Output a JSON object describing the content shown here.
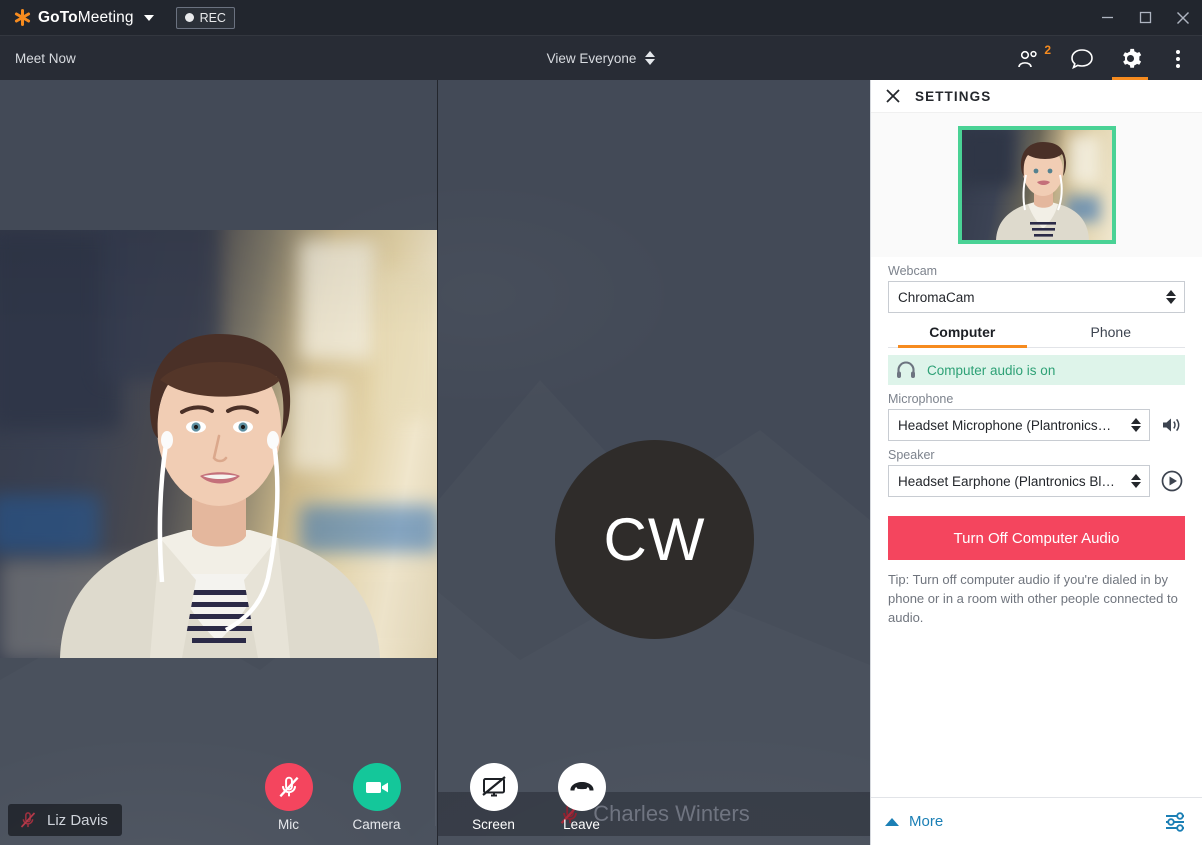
{
  "titlebar": {
    "brand_bold": "GoTo",
    "brand_rest": "Meeting",
    "logo_icon": "asterisk-logo-icon",
    "brand_caret_icon": "chevron-down-icon",
    "rec_label": "REC",
    "rec_dot_icon": "record-dot-icon",
    "minimize_icon": "minimize-icon",
    "maximize_icon": "maximize-icon",
    "close_icon": "close-icon"
  },
  "toolbar": {
    "meet_now_label": "Meet Now",
    "view_mode_label": "View Everyone",
    "view_mode_stepper_icon": "stepper-updown-icon",
    "people_icon": "people-icon",
    "people_count": "2",
    "chat_icon": "chat-bubble-icon",
    "settings_icon": "gear-icon",
    "settings_active": true,
    "overflow_icon": "kebab-menu-icon",
    "active_accent": "#f68b1f"
  },
  "stage": {
    "background_color": "#434a57",
    "local_video": {
      "name": "Liz Davis",
      "mic_state_icon": "mic-muted-icon",
      "muted": true
    },
    "remote_participant": {
      "initials": "CW",
      "name": "Charles Winters",
      "mic_state_icon": "mic-muted-icon",
      "muted": true,
      "avatar_color": "#2f2c2a"
    }
  },
  "controls": [
    {
      "id": "mic",
      "label": "Mic",
      "icon": "mic-muted-icon",
      "color": "#f4455e",
      "state": "muted"
    },
    {
      "id": "camera",
      "label": "Camera",
      "icon": "camera-on-icon",
      "color": "#14c79a",
      "state": "on"
    },
    {
      "id": "screen",
      "label": "Screen",
      "icon": "screen-share-off-icon",
      "color": "#ffffff",
      "state": "off"
    },
    {
      "id": "leave",
      "label": "Leave",
      "icon": "phone-hangup-icon",
      "color": "#ffffff",
      "state": "idle"
    }
  ],
  "settings": {
    "title": "SETTINGS",
    "close_icon": "close-icon",
    "webcam_preview": {
      "border_color": "#4ad295",
      "alt": "self-view camera preview"
    },
    "webcam": {
      "label": "Webcam",
      "value": "ChromaCam",
      "stepper_icon": "stepper-updown-icon"
    },
    "audio_tabs": [
      {
        "label": "Computer",
        "active": true
      },
      {
        "label": "Phone",
        "active": false
      }
    ],
    "audio_status": {
      "text": "Computer audio is on",
      "icon": "headset-icon",
      "bg_color": "#def4ea",
      "text_color": "#2ea176"
    },
    "microphone": {
      "label": "Microphone",
      "value": "Headset  Microphone  (Plantronics…",
      "stepper_icon": "stepper-updown-icon",
      "side_icon": "volume-level-icon"
    },
    "speaker": {
      "label": "Speaker",
      "value": "Headset  Earphone  (Plantronics  Bl…",
      "stepper_icon": "stepper-updown-icon",
      "side_icon": "play-test-icon"
    },
    "turn_off_button": {
      "label": "Turn Off Computer Audio",
      "color": "#f4455e"
    },
    "tip": "Tip: Turn off computer audio if you're dialed in by phone or in a room with other people connected to audio.",
    "more": {
      "label": "More",
      "caret_icon": "chevron-up-icon",
      "sliders_icon": "sliders-icon",
      "color": "#1b7fb5"
    }
  }
}
